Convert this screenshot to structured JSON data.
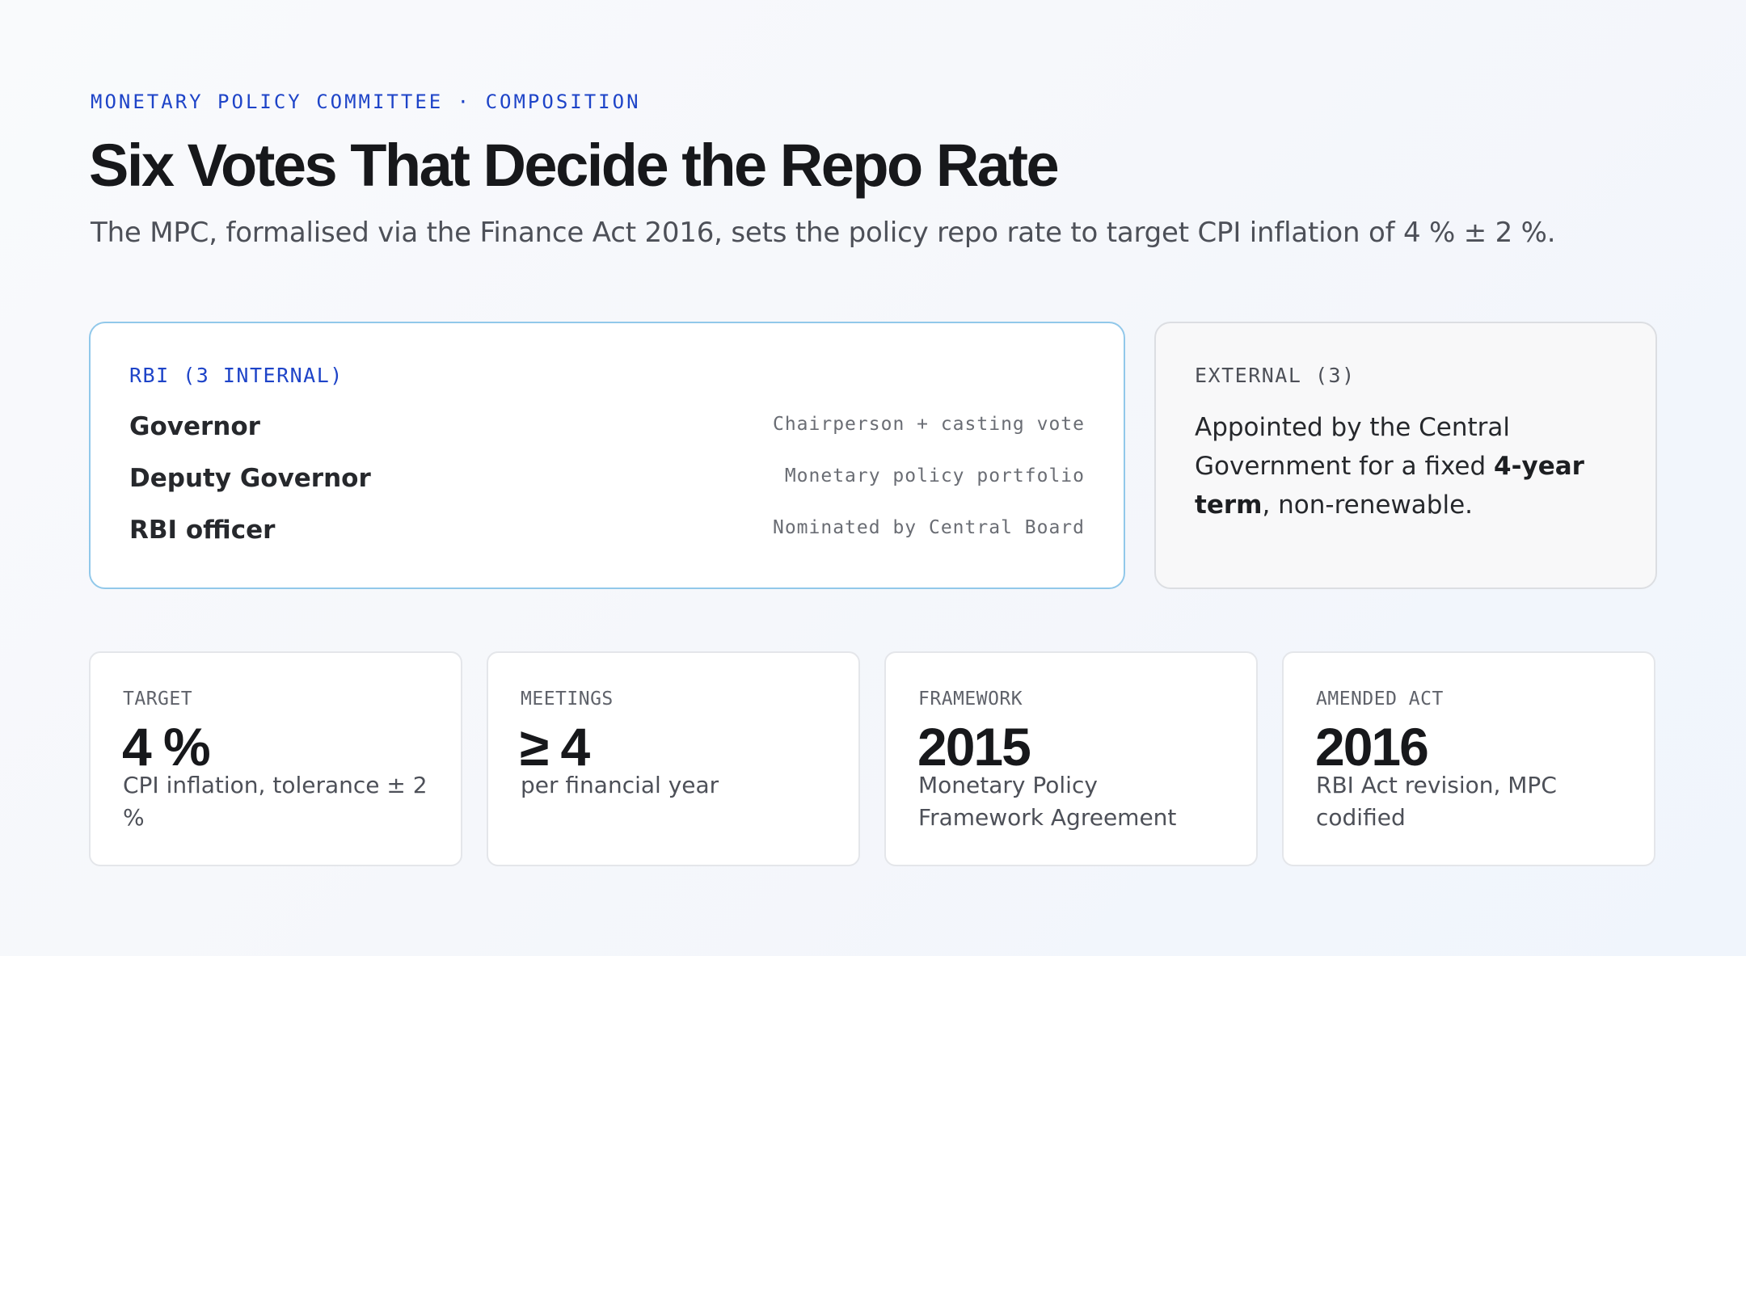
{
  "header": {
    "eyebrow": "MONETARY POLICY COMMITTEE · COMPOSITION",
    "title": "Six Votes That Decide the Repo Rate",
    "subtitle": "The MPC, formalised via the Finance Act 2016, sets the policy repo rate to target CPI inflation of 4 % ± 2 %."
  },
  "rbi_card": {
    "label": "RBI (3 INTERNAL)",
    "members": [
      {
        "name": "Governor",
        "role": "Chairperson + casting vote"
      },
      {
        "name": "Deputy Governor",
        "role": "Monetary policy portfolio"
      },
      {
        "name": "RBI officer",
        "role": "Nominated by Central Board"
      }
    ]
  },
  "external_card": {
    "label": "EXTERNAL (3)",
    "text_before": "Appointed by the Central Government for a fixed ",
    "text_bold": "4-year term",
    "text_after": ", non-renewable."
  },
  "stats": [
    {
      "label": "TARGET",
      "value": "4 %",
      "desc": "CPI inflation, tolerance ± 2 %"
    },
    {
      "label": "MEETINGS",
      "value": "≥ 4",
      "desc": "per financial year"
    },
    {
      "label": "FRAMEWORK",
      "value": "2015",
      "desc": "Monetary Policy Framework Agreement"
    },
    {
      "label": "AMENDED ACT",
      "value": "2016",
      "desc": "RBI Act revision, MPC codified"
    }
  ]
}
